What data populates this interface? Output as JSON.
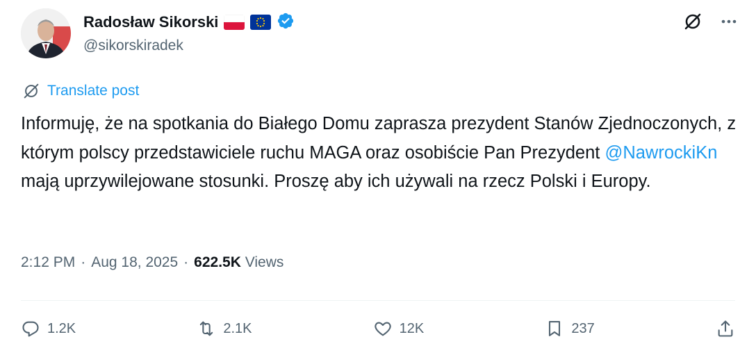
{
  "author": {
    "name": "Radosław Sikorski",
    "handle": "@sikorskiradek",
    "badges": [
      "poland-flag-icon",
      "eu-flag-icon",
      "verified-badge-icon"
    ]
  },
  "top_actions": [
    "grok-icon",
    "more-options-icon"
  ],
  "translate": {
    "label": "Translate post"
  },
  "post": {
    "text_before": "Informuję, że na spotkania do Białego Domu zaprasza prezydent Stanów Zjednoczonych, z którym polscy przedstawiciele ruchu MAGA oraz osobiście Pan Prezydent ",
    "mention": "@NawrockiKn",
    "text_after": " mają uprzywilejowane stosunki. Proszę aby ich używali na rzecz Polski i Europy."
  },
  "meta": {
    "time": "2:12 PM",
    "sep1": "·",
    "date": "Aug 18, 2025",
    "sep2": "·",
    "views_count": "622.5K",
    "views_label": "Views"
  },
  "actions": {
    "replies": "1.2K",
    "reposts": "2.1K",
    "likes": "12K",
    "bookmarks": "237"
  },
  "colors": {
    "link": "#1d9bf0",
    "secondary_text": "#536471",
    "primary_text": "#0f1419"
  }
}
